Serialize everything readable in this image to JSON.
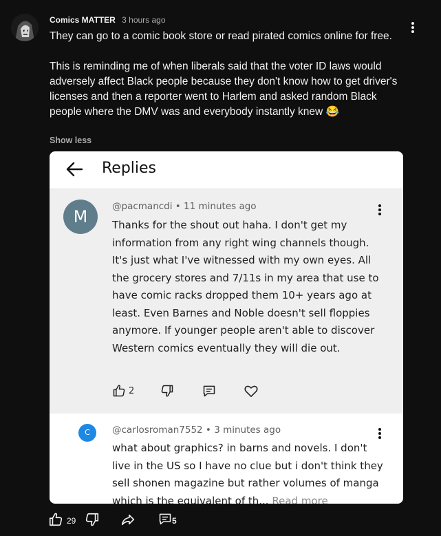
{
  "comment": {
    "author": "Comics MATTER",
    "timestamp": "3 hours ago",
    "paragraph1": "They can go to a comic book store or read pirated comics online for free.",
    "paragraph2": "This is reminding me of when liberals said that the voter ID laws would adversely affect Black people because they don't know how to get driver's licenses and then a reporter went to Harlem and asked random Black people where the DMV was and everybody instantly knew 😂",
    "show_less": "Show less",
    "like_count": "29",
    "reply_count": "5"
  },
  "embed": {
    "title": "Replies",
    "reply1": {
      "avatar_letter": "M",
      "author": "@pacmancdi",
      "age": "11 minutes ago",
      "text": "Thanks for the shout out haha. I don't get my information from any right wing channels though. It's just what I've witnessed with my own eyes. All the grocery stores and 7/11s in my area that use to have comic racks dropped them 10+ years ago at least. Even Barnes and Noble doesn't sell floppies anymore. If younger people aren't able to discover Western comics eventually they will die out.",
      "like_count": "2"
    },
    "reply2": {
      "avatar_letter": "C",
      "author": "@carlosroman7552",
      "age": "3 minutes ago",
      "text": "what about graphics? in barns and novels. I don't live in the US so I have no clue but i don't think they sell shonen magazine but rather volumes of manga which is the equivalent of th...",
      "read_more": "Read more"
    }
  },
  "colors": {
    "background": "#0f0f0f",
    "text": "#f1f1f1",
    "muted": "#aaaaaa",
    "embed_reply_bg": "#efefef",
    "avatar_m": "#607d8b",
    "avatar_c": "#1e88e5"
  },
  "icons": [
    "avatar-image",
    "kebab-menu-icon",
    "back-arrow-icon",
    "thumbs-up-icon",
    "thumbs-down-icon",
    "reply-comment-icon",
    "heart-icon",
    "share-icon",
    "comment-icon"
  ]
}
